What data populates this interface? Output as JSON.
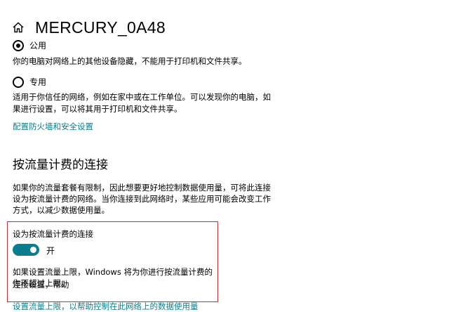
{
  "header": {
    "title": "MERCURY_0A48",
    "home_icon": "home-icon"
  },
  "network_profile": {
    "public": {
      "label": "公用",
      "selected": true,
      "description": "你的电脑对网络上的其他设备隐藏，不能用于打印机和文件共享。"
    },
    "private": {
      "label": "专用",
      "selected": false,
      "description_line1": "适用于你信任的网络，例如在家中或在工作单位。可以发现你的电脑，如",
      "description_line2": "果进行设置，可以将其用于打印机和文件共享。"
    },
    "firewall_link": "配置防火墙和安全设置"
  },
  "metered": {
    "heading": "按流量计费的连接",
    "description_line1": "如果你的流量套餐有限制，因此想要更好地控制数据使用量，可将此连接",
    "description_line2": "设为按流量计费的网络。当你连接到此网络时，某些应用可能会改变工作",
    "description_line3": "方式，以减少数据使用量。",
    "toggle_label": "设为按流量计费的连接",
    "toggle_state": "开",
    "toggle_on": true,
    "note_line1": "如果设置流量上限，Windows 将为你进行按流量计费的连接设置，帮助",
    "note_line2": "你不超过上限。",
    "cutoff_link": "设置流量上限，以帮助控制在此网络上的数据使用量"
  },
  "colors": {
    "accent": "#0a7e8c",
    "highlight_border": "#d8262e"
  }
}
